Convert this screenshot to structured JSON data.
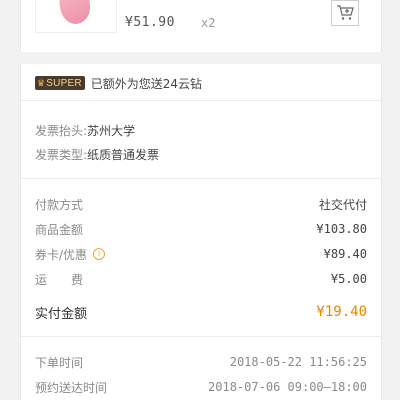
{
  "product": {
    "price": "¥51.90",
    "quantity": "x2",
    "cart_icon": "cart-add-icon"
  },
  "super": {
    "badge": "SUPER",
    "badge_icon": "crown-icon",
    "text": "已额外为您送24云钻"
  },
  "invoice": {
    "header_label": "发票抬头:",
    "header_value": "苏州大学",
    "type_label": "发票类型:",
    "type_value": "纸质普通发票"
  },
  "payment": {
    "method_label": "付款方式",
    "method_value": "社交代付",
    "goods_label": "商品金额",
    "goods_value": "¥103.80",
    "coupon_label": "券卡/优惠",
    "coupon_icon": "info-icon",
    "coupon_value": "¥89.40",
    "shipping_label": "运　　费",
    "shipping_value": "¥5.00",
    "paid_label": "实付金额",
    "paid_value": "¥19.40"
  },
  "times": {
    "order_label": "下单时间",
    "order_value": "2018-05-22  11:56:25",
    "delivery_label": "预约送达时间",
    "delivery_value": "2018-07-06  09:00—18:00"
  },
  "colors": {
    "accent": "#f08300",
    "background": "#f2f2f2"
  }
}
